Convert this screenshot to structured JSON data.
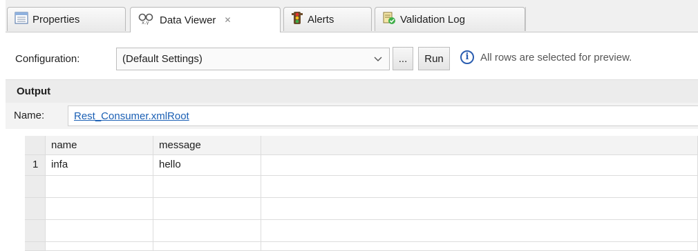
{
  "tabs": [
    {
      "label": "Properties",
      "icon": "properties-icon"
    },
    {
      "label": "Data Viewer",
      "icon": "data-viewer-icon",
      "close": "✕"
    },
    {
      "label": "Alerts",
      "icon": "alerts-icon"
    },
    {
      "label": "Validation Log",
      "icon": "validation-log-icon"
    }
  ],
  "toolbar": {
    "configuration_label": "Configuration:",
    "configuration_value": "(Default Settings)",
    "more_button": "...",
    "run_button": "Run",
    "info_text": "All rows are selected for preview."
  },
  "output": {
    "header": "Output",
    "name_label": "Name:",
    "name_value": "Rest_Consumer.xmlRoot"
  },
  "grid": {
    "columns": [
      "name",
      "message"
    ],
    "rows": [
      {
        "num": "1",
        "name": "infa",
        "message": "hello"
      }
    ]
  },
  "colors": {
    "link": "#1a5fb4",
    "info": "#2a5db0"
  }
}
